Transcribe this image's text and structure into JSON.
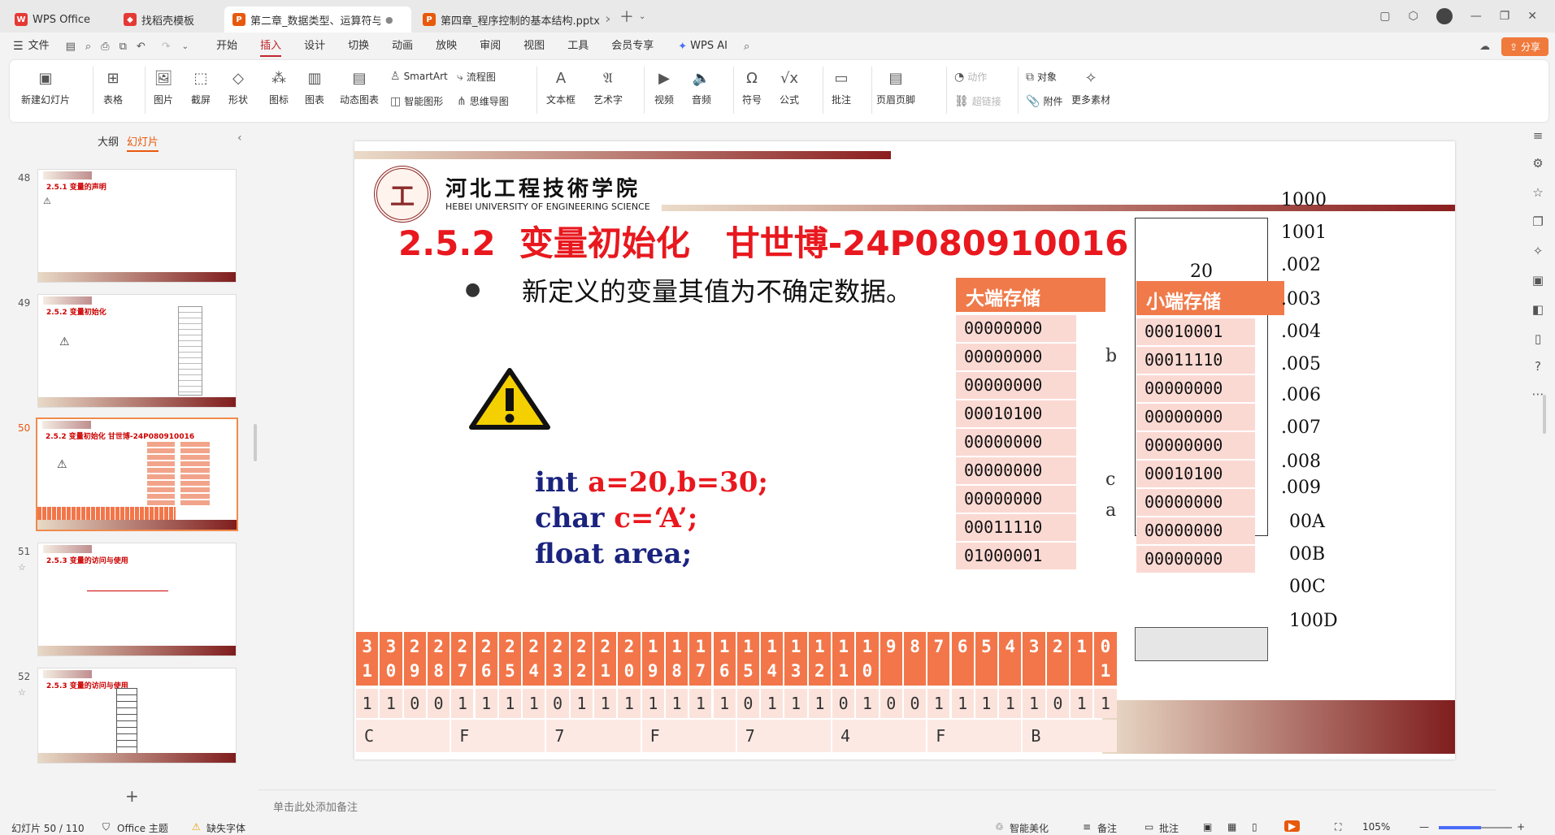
{
  "tabs": [
    {
      "label": "WPS Office",
      "icon": "wps-logo-icon",
      "color": "#e53935"
    },
    {
      "label": "找稻壳模板",
      "icon": "docer-icon",
      "color": "#e53935"
    },
    {
      "label": "第二章_数据类型、运算符与表",
      "icon": "ppt-icon",
      "color": "#e8590c",
      "active": true
    },
    {
      "label": "第四章_程序控制的基本结构.pptx",
      "icon": "ppt-icon",
      "color": "#e8590c"
    }
  ],
  "menu": {
    "file": "文件",
    "items": [
      "开始",
      "插入",
      "设计",
      "切换",
      "动画",
      "放映",
      "审阅",
      "视图",
      "工具",
      "会员专享"
    ],
    "active": "插入",
    "wpsai": "WPS AI",
    "share": "分享"
  },
  "ribbon": {
    "new_slide": "新建幻灯片",
    "table": "表格",
    "picture": "图片",
    "screenshot": "截屏",
    "shape": "形状",
    "icons": "图标",
    "chart": "图表",
    "dyn_chart": "动态图表",
    "smartart": "SmartArt",
    "smart_graphic": "智能图形",
    "flowchart": "流程图",
    "mindmap": "思维导图",
    "textbox": "文本框",
    "wordart": "艺术字",
    "video": "视频",
    "audio": "音频",
    "symbol": "符号",
    "formula": "公式",
    "comment": "批注",
    "header_footer": "页眉页脚",
    "action": "动作",
    "hyperlink": "超链接",
    "object": "对象",
    "attachment": "附件",
    "more": "更多素材"
  },
  "panel": {
    "outline": "大纲",
    "slides": "幻灯片"
  },
  "thumbs": [
    {
      "num": "48",
      "title": "2.5.1 变量的声明"
    },
    {
      "num": "49",
      "title": "2.5.2 变量初始化"
    },
    {
      "num": "50",
      "title": "2.5.2 变量初始化  甘世博-24P080910016"
    },
    {
      "num": "51",
      "title": "2.5.3 变量的访问与使用"
    },
    {
      "num": "52",
      "title": "2.5.3 变量的访问与使用"
    }
  ],
  "slide": {
    "school_cn": "河北工程技術学院",
    "school_en": "HEBEI UNIVERSITY OF ENGINEERING SCIENCE",
    "title": "2.5.2  变量初始化   甘世博-24P080910016",
    "bullet": "新定义的变量其值为不确定数据。",
    "code": [
      {
        "kw": "int ",
        "rest": "a=20,b=30;"
      },
      {
        "kw": "char ",
        "rest": "c=‘A’;"
      },
      {
        "kw": "float area;",
        "rest": ""
      }
    ],
    "big_endian_title": "大端存储",
    "little_endian_title": "小端存储",
    "big_rows": [
      "00000000",
      "00000000",
      "00000000",
      "00010100",
      "00000000",
      "00000000",
      "00000000",
      "00011110",
      "01000001"
    ],
    "little_rows": [
      "00010001",
      "00011110",
      "00000000",
      "00000000",
      "00000000",
      "00010100",
      "00000000",
      "00000000",
      "00000000"
    ],
    "mem_value": "20",
    "var_labels": [
      "b",
      "c",
      "a"
    ],
    "addresses": [
      "1000",
      "1001",
      ".002",
      ".003",
      ".004",
      ".005",
      ".006",
      ".007",
      ".008",
      ".009",
      "00A",
      "00B",
      "00C",
      "100D"
    ],
    "bit_headers": [
      "3\n1",
      "3\n0",
      "2\n9",
      "2\n8",
      "2\n7",
      "2\n6",
      "2\n5",
      "2\n4",
      "2\n3",
      "2\n2",
      "2\n1",
      "2\n0",
      "1\n9",
      "1\n8",
      "1\n7",
      "1\n6",
      "1\n5",
      "1\n4",
      "1\n3",
      "1\n2",
      "1\n1",
      "1\n0",
      "9",
      "8",
      "7",
      "6",
      "5",
      "4",
      "3",
      "2",
      "1",
      "0\n1"
    ],
    "bit_values": [
      "1",
      "1",
      "0",
      "0",
      "1",
      "1",
      "1",
      "1",
      "0",
      "1",
      "1",
      "1",
      "1",
      "1",
      "1",
      "1",
      "0",
      "1",
      "1",
      "1",
      "0",
      "1",
      "0",
      "0",
      "1",
      "1",
      "1",
      "1",
      "1",
      "0",
      "1",
      "1"
    ],
    "hex_values": [
      "C",
      "F",
      "7",
      "F",
      "7",
      "4",
      "F",
      "B"
    ]
  },
  "notes_placeholder": "单击此处添加备注",
  "status": {
    "slide_count": "幻灯片 50 / 110",
    "theme": "Office 主题",
    "missing_font": "缺失字体",
    "beautify": "智能美化",
    "notes": "备注",
    "comment": "批注",
    "zoom": "105%"
  }
}
